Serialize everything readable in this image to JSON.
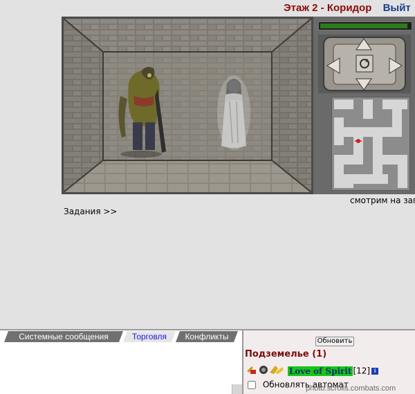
{
  "header": {
    "location": "Этаж 2 - Коридор",
    "exit": "Выйт"
  },
  "side_panel": {
    "health_fraction": 0.97
  },
  "caption": "смотрим на зап",
  "tasks_link": "Задания >>",
  "chat": {
    "tabs": [
      {
        "label": "Системные сообщения",
        "active": false
      },
      {
        "label": "Торговля",
        "active": true
      },
      {
        "label": "Конфликты",
        "active": false
      }
    ]
  },
  "online": {
    "refresh_button": "Обновить",
    "location_heading": "Подземелье (1)",
    "players": [
      {
        "name": "Love of Spirit",
        "level": "[12]",
        "info": "i"
      }
    ],
    "auto_refresh_label": "Обновлять автомат",
    "watermark": "photo.scrolls.combats.com"
  },
  "colors": {
    "location_title": "#8b0a0a",
    "exit_link": "#1c3f8c",
    "player_name_bg": "#14c814",
    "active_tab_text": "#1a1ae6"
  }
}
